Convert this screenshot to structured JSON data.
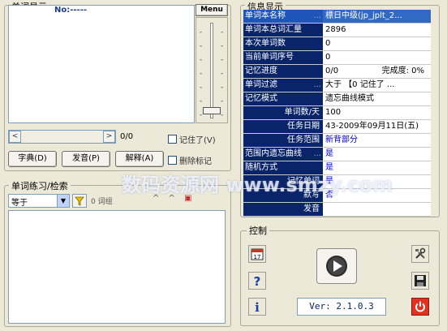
{
  "word_display": {
    "title": "单词显示",
    "no_label": "No:-----",
    "menu_label": "Menu",
    "counter": "0/0",
    "remembered_label": "记住了(V)",
    "buttons": {
      "dictionary": "字典(D)",
      "pronounce": "发音(P)",
      "explain": "解释(A)"
    },
    "delete_mark_label": "删除标记"
  },
  "practice": {
    "title": "单词练习/检索",
    "match_option": "等于",
    "count_text": "0 词组"
  },
  "info": {
    "title": "信息显示",
    "rows": [
      {
        "label": "单词本名称",
        "value": "標日中级(jp_jplt_2..."
      },
      {
        "label": "单词本总词汇量",
        "value": "2896"
      },
      {
        "label": "本次单词数",
        "value": "0"
      },
      {
        "label": "当前单词序号",
        "value": "0"
      },
      {
        "label": "记忆进度",
        "value": "0/0",
        "extra": "完成度: 0%"
      },
      {
        "label": "单词过滤",
        "value": "大于  【0 记住了 ..."
      },
      {
        "label": "记忆模式",
        "value": "遗忘曲线模式"
      },
      {
        "label": "单词数/天",
        "value": "100"
      },
      {
        "label": "任务日期",
        "value": "43-2009年09月11日(五)"
      },
      {
        "label": "任务范围",
        "value": "新背部分"
      },
      {
        "label": "范围内遗忘曲线",
        "value": "是"
      },
      {
        "label": "随机方式",
        "value": "是"
      },
      {
        "label": "记忆单词",
        "value": "是"
      },
      {
        "label": "默写",
        "value": "否"
      },
      {
        "label": "发音",
        "value": ""
      }
    ]
  },
  "control": {
    "title": "控制",
    "version": "Ver: 2.1.0.3"
  },
  "watermark": "数码资源网 www.smzy.com",
  "colors": {
    "label_bg": "#0a246a",
    "selected_bg": "#316ac5",
    "window_bg": "#ece9d8"
  }
}
